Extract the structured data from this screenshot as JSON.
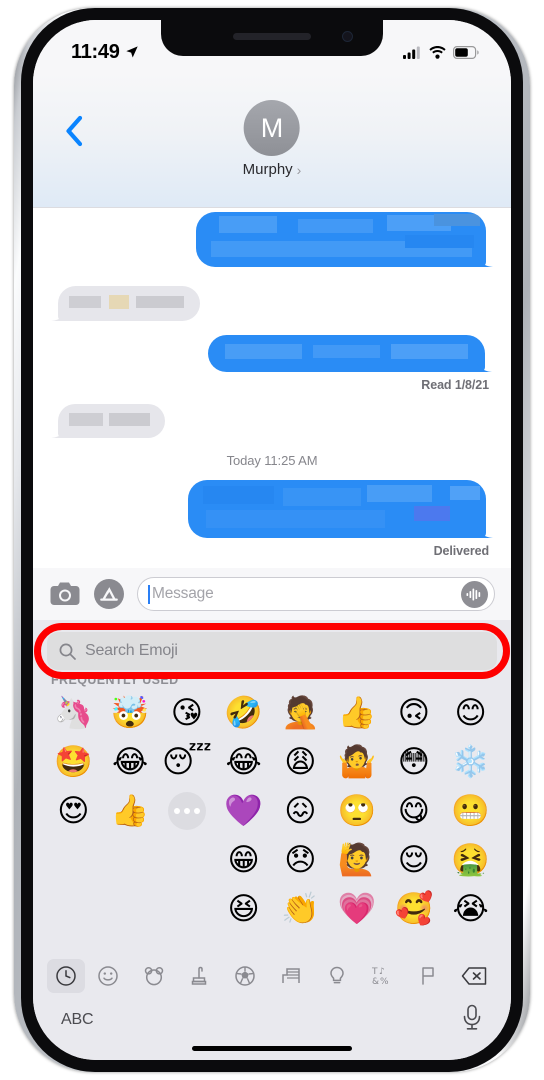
{
  "device": {
    "frame": "iphone-silver",
    "accent_red": "#fe0000",
    "imessage_blue": "#2a8cf5"
  },
  "status_bar": {
    "time": "11:49",
    "location_icon": "location-arrow-icon",
    "signal_icon": "cellular-signal-icon",
    "wifi_icon": "wifi-icon",
    "battery_icon": "battery-icon",
    "signal_bars_filled": 3,
    "battery_level_pct": 60
  },
  "nav_bar": {
    "back_icon": "chevron-left-icon",
    "avatar_initial": "M",
    "contact_name": "Murphy",
    "contact_chevron": "›"
  },
  "conversation": {
    "messages": [
      {
        "side": "outgoing",
        "redacted": true
      },
      {
        "side": "incoming",
        "redacted": true
      },
      {
        "side": "outgoing",
        "redacted": true
      },
      {
        "side": "incoming",
        "redacted": true
      },
      {
        "side": "outgoing",
        "redacted": true
      }
    ],
    "read_receipt": "Read 1/8/21",
    "time_divider": "Today 11:25 AM",
    "delivered_receipt": "Delivered"
  },
  "input_bar": {
    "camera_icon": "camera-icon",
    "apps_icon": "app-store-icon",
    "message_placeholder": "Message",
    "message_value": "",
    "audio_icon": "audio-waveform-icon"
  },
  "emoji_keyboard": {
    "search_icon": "magnifying-glass-icon",
    "search_placeholder": "Search Emoji",
    "search_value": "",
    "section_header": "FREQUENTLY USED",
    "memoji": [
      {
        "name": "memoji-unicorn",
        "glyph": "🦄"
      },
      {
        "name": "memoji-mind-blown",
        "glyph": "🤯"
      },
      {
        "name": "memoji-kiss",
        "glyph": "😘"
      },
      {
        "name": "memoji-star-eyes",
        "glyph": "🤩"
      },
      {
        "name": "memoji-laughing-tears",
        "glyph": "😂"
      },
      {
        "name": "memoji-sleeping",
        "glyph": "😴"
      },
      {
        "name": "memoji-heart-eyes",
        "glyph": "😍"
      },
      {
        "name": "memoji-thumbs-up",
        "glyph": "👍"
      }
    ],
    "memoji_more": "more-memoji-button",
    "emoji": [
      {
        "name": "rolling-on-the-floor-laughing",
        "glyph": "🤣"
      },
      {
        "name": "person-facepalming",
        "glyph": "🤦"
      },
      {
        "name": "thumbs-up",
        "glyph": "👍"
      },
      {
        "name": "upside-down-face",
        "glyph": "🙃"
      },
      {
        "name": "smiling-face-smiling-eyes",
        "glyph": "😊"
      },
      {
        "name": "face-with-tears-of-joy",
        "glyph": "😂"
      },
      {
        "name": "weary-face",
        "glyph": "😩"
      },
      {
        "name": "person-shrugging",
        "glyph": "🤷"
      },
      {
        "name": "flushed-face",
        "glyph": "😳"
      },
      {
        "name": "snowflake",
        "glyph": "❄️"
      },
      {
        "name": "purple-heart",
        "glyph": "💜"
      },
      {
        "name": "confounded-face",
        "glyph": "😖"
      },
      {
        "name": "face-with-rolling-eyes",
        "glyph": "🙄"
      },
      {
        "name": "face-savoring-food",
        "glyph": "😋"
      },
      {
        "name": "grimacing-face",
        "glyph": "😬"
      },
      {
        "name": "beaming-face",
        "glyph": "😁"
      },
      {
        "name": "disappointed-face",
        "glyph": "😞"
      },
      {
        "name": "person-raising-hand",
        "glyph": "🙋"
      },
      {
        "name": "relieved-face",
        "glyph": "😌"
      },
      {
        "name": "face-vomiting",
        "glyph": "🤮"
      },
      {
        "name": "squinting-face-with-tongue",
        "glyph": "😆"
      },
      {
        "name": "clapping-hands",
        "glyph": "👏"
      },
      {
        "name": "growing-heart",
        "glyph": "💗"
      },
      {
        "name": "smiling-face-with-hearts",
        "glyph": "🥰"
      },
      {
        "name": "loudly-crying-face",
        "glyph": "😭"
      }
    ],
    "categories": [
      {
        "name": "category-recent",
        "icon": "clock-icon",
        "active": true
      },
      {
        "name": "category-smileys",
        "icon": "smiley-icon",
        "active": false
      },
      {
        "name": "category-animals",
        "icon": "bear-icon",
        "active": false
      },
      {
        "name": "category-food",
        "icon": "food-icon",
        "active": false
      },
      {
        "name": "category-activity",
        "icon": "soccer-ball-icon",
        "active": false
      },
      {
        "name": "category-travel",
        "icon": "car-icon",
        "active": false
      },
      {
        "name": "category-objects",
        "icon": "lightbulb-icon",
        "active": false
      },
      {
        "name": "category-symbols",
        "icon": "symbols-icon",
        "active": false
      },
      {
        "name": "category-flags",
        "icon": "flag-icon",
        "active": false
      },
      {
        "name": "category-delete",
        "icon": "backspace-icon",
        "active": false
      }
    ],
    "abc_label": "ABC",
    "dictation_icon": "microphone-icon"
  }
}
